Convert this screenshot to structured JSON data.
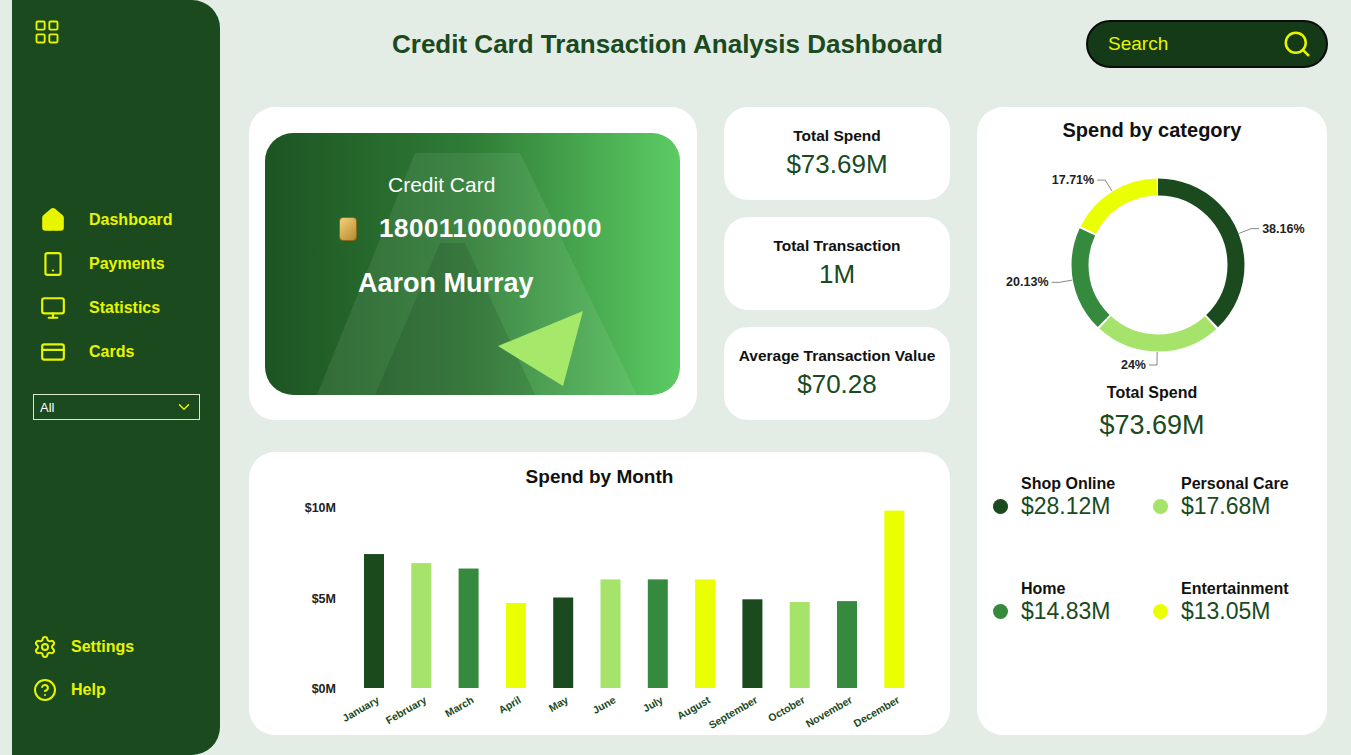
{
  "title": "Credit Card Transaction Analysis Dashboard",
  "search": {
    "placeholder": "Search"
  },
  "sidebar": {
    "items": [
      {
        "label": "Dashboard"
      },
      {
        "label": "Payments"
      },
      {
        "label": "Statistics"
      },
      {
        "label": "Cards"
      }
    ],
    "filter": {
      "value": "All"
    },
    "footer_items": [
      {
        "label": "Settings"
      },
      {
        "label": "Help"
      }
    ]
  },
  "card": {
    "label": "Credit Card",
    "number": "180011000000000",
    "holder": "Aaron Murray"
  },
  "kpis": [
    {
      "label": "Total Spend",
      "value": "$73.69M"
    },
    {
      "label": "Total Transaction",
      "value": "1M"
    },
    {
      "label": "Average Transaction Value",
      "value": "$70.28"
    }
  ],
  "category": {
    "title": "Spend by category",
    "total_label": "Total Spend",
    "total_value": "$73.69M",
    "segments": [
      {
        "name": "Shop Online",
        "share": 38.16,
        "percent_label": "38.16%",
        "value": "$28.12M",
        "color": "#1b4a1e"
      },
      {
        "name": "Personal Care",
        "share": 24,
        "percent_label": "24%",
        "value": "$17.68M",
        "color": "#a6e36a"
      },
      {
        "name": "Home",
        "share": 20.13,
        "percent_label": "20.13%",
        "value": "$14.83M",
        "color": "#358a3e"
      },
      {
        "name": "Entertainment",
        "share": 17.71,
        "percent_label": "17.71%",
        "value": "$13.05M",
        "color": "#eaff00"
      }
    ]
  },
  "monthly": {
    "title": "Spend by Month",
    "ticks": [
      "$10M",
      "$5M",
      "$0M"
    ],
    "axis_max": 10,
    "months": [
      "January",
      "February",
      "March",
      "April",
      "May",
      "June",
      "July",
      "August",
      "September",
      "October",
      "November",
      "December"
    ],
    "values": [
      7.4,
      6.9,
      6.6,
      4.7,
      5.0,
      6.0,
      6.0,
      6.0,
      4.9,
      4.75,
      4.8,
      9.8
    ],
    "colors": [
      "#1b4a1e",
      "#a6e36a",
      "#358a3e",
      "#eaff00",
      "#1b4a1e",
      "#a6e36a",
      "#358a3e",
      "#eaff00",
      "#1b4a1e",
      "#a6e36a",
      "#358a3e",
      "#eaff00"
    ]
  }
}
